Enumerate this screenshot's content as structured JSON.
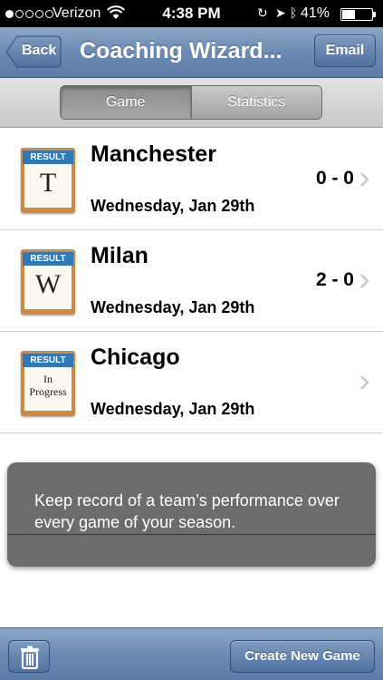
{
  "status_bar": {
    "carrier": "Verizon",
    "time": "4:38 PM",
    "battery": "41%",
    "battery_level": 0.41,
    "signal_bars": 1
  },
  "nav": {
    "back_label": "Back",
    "title": "Coaching Wizard...",
    "email_label": "Email"
  },
  "segments": [
    {
      "label": "Game",
      "selected": true
    },
    {
      "label": "Statistics",
      "selected": false
    }
  ],
  "games": [
    {
      "badge": "RESULT",
      "result": "T",
      "team": "Manchester",
      "date": "Wednesday, Jan 29th",
      "score": "0 - 0"
    },
    {
      "badge": "RESULT",
      "result": "W",
      "team": "Milan",
      "date": "Wednesday, Jan 29th",
      "score": "2 - 0"
    },
    {
      "badge": "RESULT",
      "result_line1": "In",
      "result_line2": "Progress",
      "team": "Chicago",
      "date": "Wednesday, Jan 29th",
      "score": ""
    }
  ],
  "tip": {
    "text": "Keep record of a team’s performance over every game of your season."
  },
  "toolbar": {
    "trash_icon": "trash-icon",
    "create_label": "Create New Game"
  },
  "colors": {
    "nav_blue": "#6a8bb3",
    "result_banner": "#2f79b9",
    "result_frame": "#c98a4a"
  }
}
